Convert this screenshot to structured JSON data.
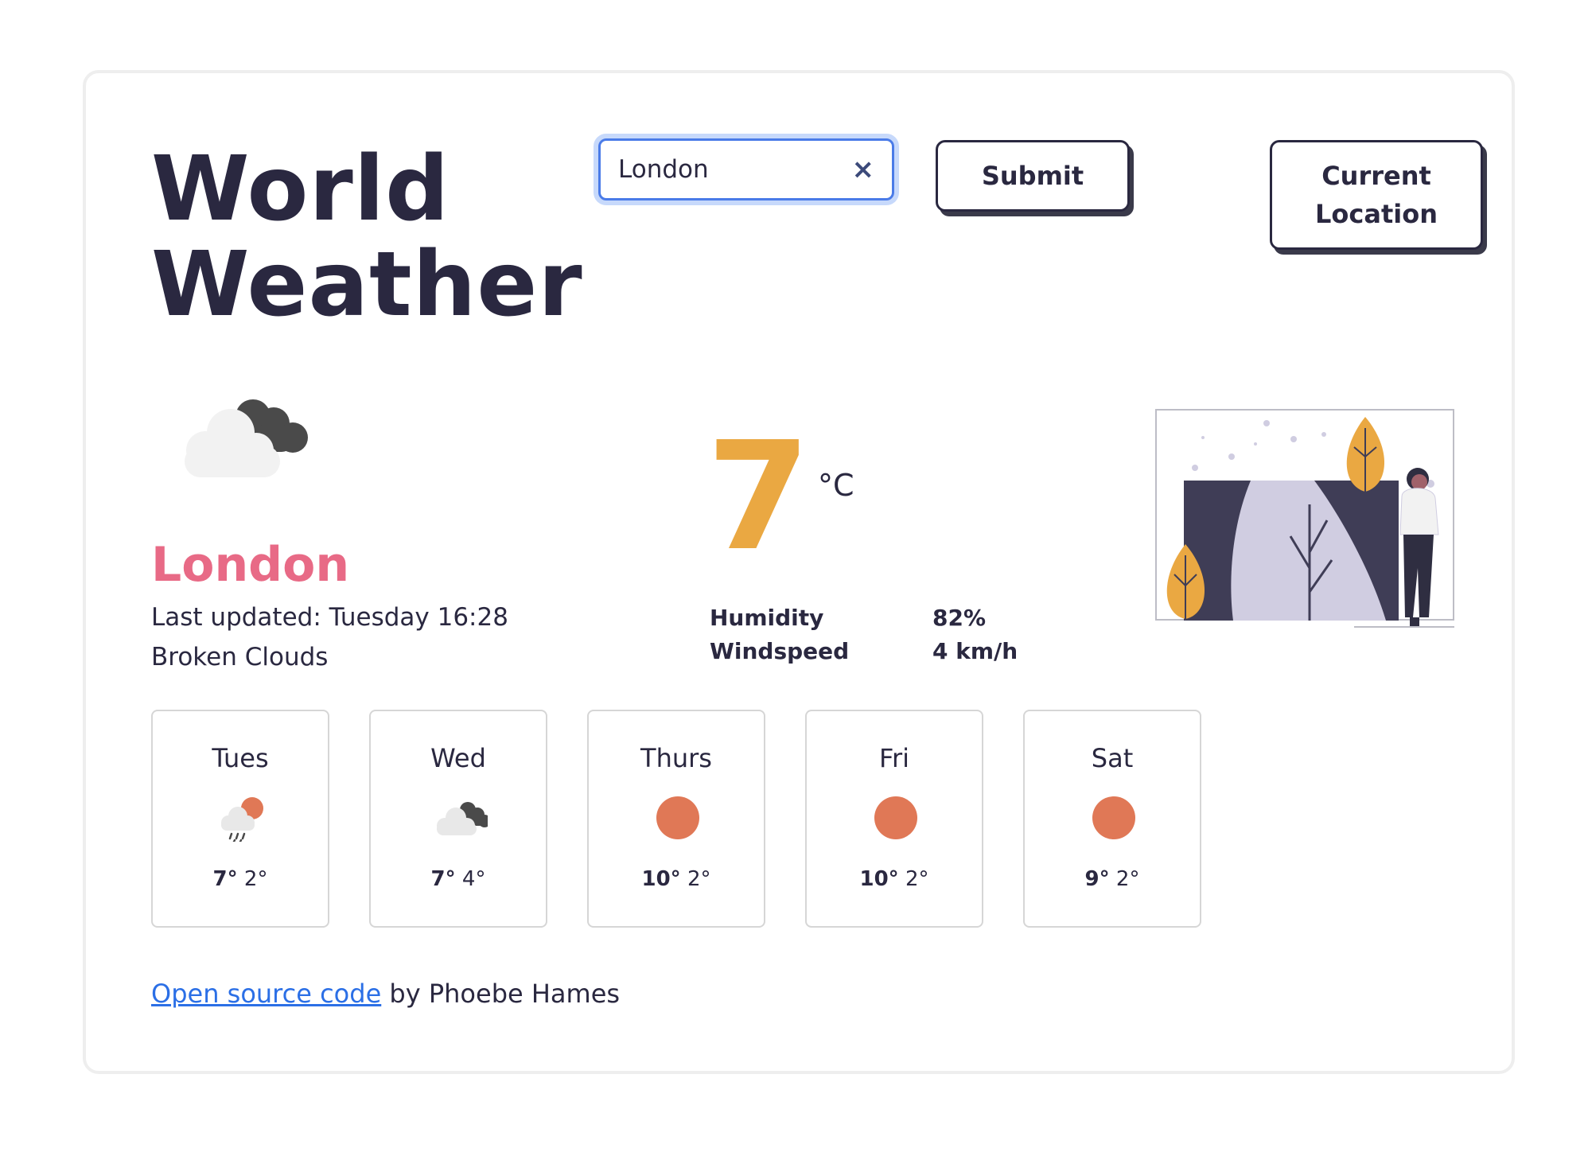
{
  "header": {
    "title_line1": "World",
    "title_line2": "Weather"
  },
  "search": {
    "value": "London",
    "clear_icon": "×",
    "submit_label": "Submit",
    "location_label_line1": "Current",
    "location_label_line2": "Location"
  },
  "current": {
    "icon": "broken-clouds-icon",
    "city": "London",
    "updated": "Last updated: Tuesday 16:28",
    "description": "Broken Clouds",
    "temperature": "7",
    "unit": "°C",
    "humidity_label": "Humidity",
    "humidity_value": "82%",
    "wind_label": "Windspeed",
    "wind_value": "4 km/h"
  },
  "forecast": [
    {
      "day": "Tues",
      "icon": "rain-sun-icon",
      "high": "7°",
      "low": "2°"
    },
    {
      "day": "Wed",
      "icon": "broken-clouds-icon",
      "high": "7°",
      "low": "4°"
    },
    {
      "day": "Thurs",
      "icon": "sun-icon",
      "high": "10°",
      "low": "2°"
    },
    {
      "day": "Fri",
      "icon": "sun-icon",
      "high": "10°",
      "low": "2°"
    },
    {
      "day": "Sat",
      "icon": "sun-icon",
      "high": "9°",
      "low": "2°"
    }
  ],
  "footer": {
    "link_text": "Open source code",
    "suffix": " by Phoebe Hames"
  },
  "colors": {
    "accent_city": "#e86a86",
    "accent_temp": "#eaa842",
    "sun": "#e07856",
    "text": "#2a2840"
  }
}
